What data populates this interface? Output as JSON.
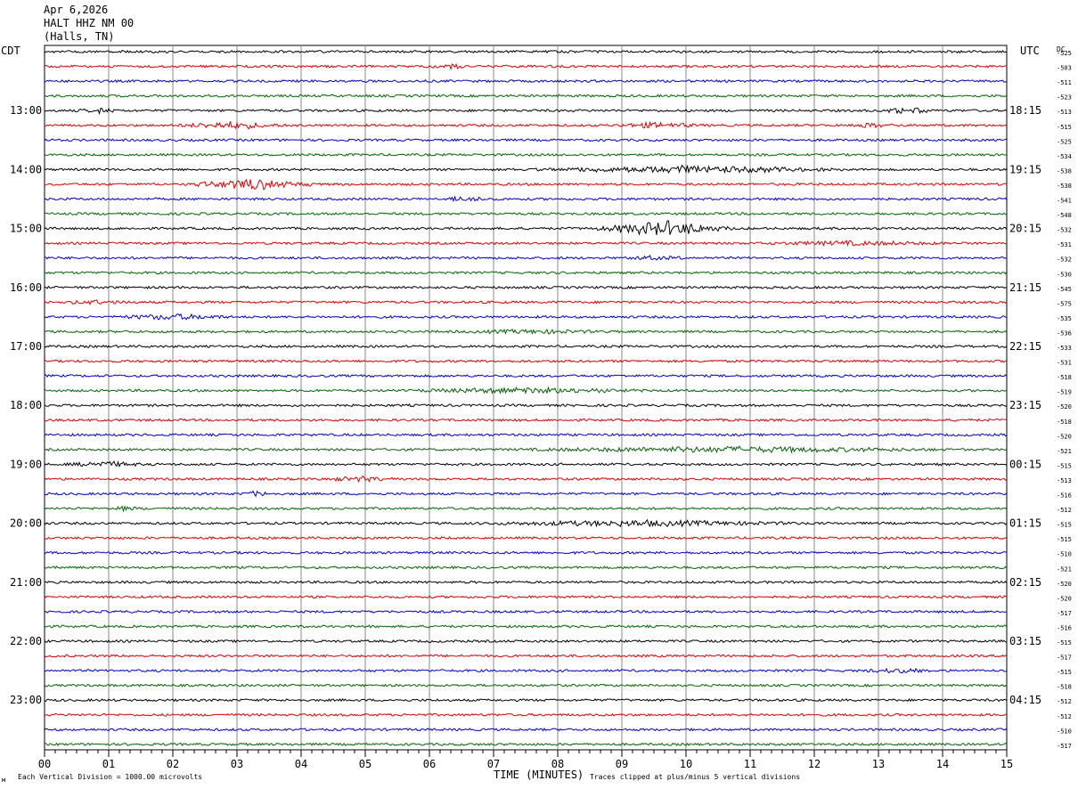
{
  "header": {
    "date": "Apr 6,2026",
    "station": "HALT HHZ NM 00",
    "location": "(Halls, TN)"
  },
  "chart_data": {
    "type": "helicorder",
    "title": "Apr 6,2026",
    "left_axis_label": "CDT",
    "right_axis_label": "UTC",
    "dc_label": "DC",
    "xlabel": "TIME (MINUTES)",
    "x_ticks": [
      "00",
      "01",
      "02",
      "03",
      "04",
      "05",
      "06",
      "07",
      "08",
      "09",
      "10",
      "11",
      "12",
      "13",
      "14",
      "15"
    ],
    "xlim": [
      0,
      15
    ],
    "rows_count": 48,
    "trace_colors": [
      "#000000",
      "#dd0000",
      "#0000cc",
      "#006600"
    ],
    "left_time_labels": [
      {
        "row": 4,
        "text": "13:00"
      },
      {
        "row": 8,
        "text": "14:00"
      },
      {
        "row": 12,
        "text": "15:00"
      },
      {
        "row": 16,
        "text": "16:00"
      },
      {
        "row": 20,
        "text": "17:00"
      },
      {
        "row": 24,
        "text": "18:00"
      },
      {
        "row": 28,
        "text": "19:00"
      },
      {
        "row": 32,
        "text": "20:00"
      },
      {
        "row": 36,
        "text": "21:00"
      },
      {
        "row": 40,
        "text": "22:00"
      },
      {
        "row": 44,
        "text": "23:00"
      }
    ],
    "right_time_labels": [
      {
        "row": 4,
        "text": "18:15"
      },
      {
        "row": 8,
        "text": "19:15"
      },
      {
        "row": 12,
        "text": "20:15"
      },
      {
        "row": 16,
        "text": "21:15"
      },
      {
        "row": 20,
        "text": "22:15"
      },
      {
        "row": 24,
        "text": "23:15"
      },
      {
        "row": 28,
        "text": "00:15"
      },
      {
        "row": 32,
        "text": "01:15"
      },
      {
        "row": 36,
        "text": "02:15"
      },
      {
        "row": 40,
        "text": "03:15"
      },
      {
        "row": 44,
        "text": "04:15"
      }
    ],
    "dc_offsets": [
      "-525",
      "-503",
      "-511",
      "-523",
      "-513",
      "-515",
      "-525",
      "-534",
      "-538",
      "-538",
      "-541",
      "-548",
      "-532",
      "-531",
      "-532",
      "-530",
      "-545",
      "-575",
      "-535",
      "-536",
      "-533",
      "-531",
      "-518",
      "-519",
      "-520",
      "-518",
      "-520",
      "-521",
      "-515",
      "-513",
      "-516",
      "-512",
      "-515",
      "-515",
      "-510",
      "-521",
      "-520",
      "-520",
      "-517",
      "-516",
      "-515",
      "-517",
      "-515",
      "-518",
      "-512",
      "-512",
      "-510",
      "-517"
    ],
    "events": [
      {
        "row": 1,
        "start": 6.0,
        "end": 6.6,
        "amp": 3
      },
      {
        "row": 4,
        "start": 0.5,
        "end": 1.2,
        "amp": 2
      },
      {
        "row": 4,
        "start": 13.0,
        "end": 13.9,
        "amp": 3
      },
      {
        "row": 5,
        "start": 2.0,
        "end": 3.8,
        "amp": 4
      },
      {
        "row": 5,
        "start": 8.8,
        "end": 10.3,
        "amp": 3
      },
      {
        "row": 5,
        "start": 12.4,
        "end": 13.3,
        "amp": 2
      },
      {
        "row": 8,
        "start": 7.5,
        "end": 12.5,
        "amp": 4
      },
      {
        "row": 9,
        "start": 2.2,
        "end": 4.3,
        "amp": 6
      },
      {
        "row": 10,
        "start": 6.2,
        "end": 7.0,
        "amp": 3
      },
      {
        "row": 12,
        "start": 8.5,
        "end": 10.8,
        "amp": 9
      },
      {
        "row": 13,
        "start": 11.0,
        "end": 14.2,
        "amp": 2
      },
      {
        "row": 14,
        "start": 9.0,
        "end": 10.0,
        "amp": 2
      },
      {
        "row": 17,
        "start": 0.2,
        "end": 1.4,
        "amp": 2
      },
      {
        "row": 18,
        "start": 1.0,
        "end": 3.0,
        "amp": 3
      },
      {
        "row": 19,
        "start": 6.5,
        "end": 8.8,
        "amp": 2
      },
      {
        "row": 23,
        "start": 5.5,
        "end": 9.5,
        "amp": 3
      },
      {
        "row": 27,
        "start": 7.2,
        "end": 14.2,
        "amp": 3
      },
      {
        "row": 28,
        "start": 0.3,
        "end": 1.6,
        "amp": 3
      },
      {
        "row": 29,
        "start": 4.3,
        "end": 5.5,
        "amp": 3
      },
      {
        "row": 30,
        "start": 3.1,
        "end": 3.5,
        "amp": 3
      },
      {
        "row": 31,
        "start": 1.0,
        "end": 1.5,
        "amp": 2
      },
      {
        "row": 32,
        "start": 6.5,
        "end": 12.0,
        "amp": 3
      },
      {
        "row": 42,
        "start": 12.7,
        "end": 14.0,
        "amp": 2
      }
    ]
  },
  "footer": {
    "scale_note": "Each Vertical Division = 1000.00 microvolts",
    "clip_note": "Traces clipped at plus/minus 5 vertical divisions",
    "corner_mark": "м"
  }
}
